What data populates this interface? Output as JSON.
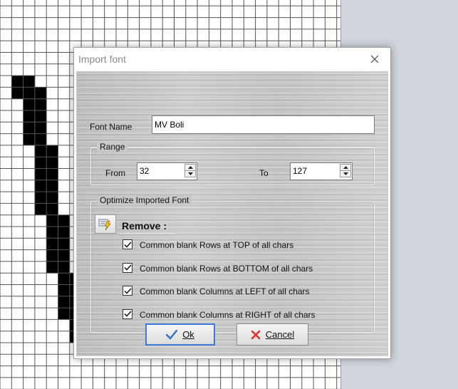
{
  "dialog": {
    "title": "Import font",
    "font_name_label": "Font Name",
    "font_name_value": "MV Boli",
    "range": {
      "title": "Range",
      "from_label": "From",
      "from_value": "32",
      "to_label": "To",
      "to_value": "127"
    },
    "optimize": {
      "title": "Optimize Imported Font",
      "remove_label": "Remove :",
      "options": [
        {
          "label": "Common blank Rows at TOP of all chars",
          "checked": true
        },
        {
          "label": "Common blank Rows at BOTTOM of all chars",
          "checked": true
        },
        {
          "label": "Common blank Columns at LEFT of all chars",
          "checked": true
        },
        {
          "label": "Common blank Columns at RIGHT of all chars",
          "checked": true
        }
      ]
    },
    "ok_label": "Ok",
    "cancel_label": "Cancel"
  },
  "colors": {
    "accent": "#3d7bd8",
    "cancel_icon": "#e0332b",
    "ok_icon": "#2f6fd0"
  },
  "background_glyph_pixels": [
    [
      1,
      7
    ],
    [
      2,
      7
    ],
    [
      1,
      8
    ],
    [
      2,
      8
    ],
    [
      3,
      8
    ],
    [
      2,
      9
    ],
    [
      3,
      9
    ],
    [
      2,
      10
    ],
    [
      3,
      10
    ],
    [
      2,
      11
    ],
    [
      3,
      11
    ],
    [
      2,
      12
    ],
    [
      3,
      12
    ],
    [
      3,
      13
    ],
    [
      4,
      13
    ],
    [
      3,
      14
    ],
    [
      4,
      14
    ],
    [
      3,
      15
    ],
    [
      4,
      15
    ],
    [
      3,
      16
    ],
    [
      4,
      16
    ],
    [
      3,
      17
    ],
    [
      4,
      17
    ],
    [
      3,
      18
    ],
    [
      4,
      18
    ],
    [
      4,
      19
    ],
    [
      5,
      19
    ],
    [
      4,
      20
    ],
    [
      5,
      20
    ],
    [
      4,
      21
    ],
    [
      5,
      21
    ],
    [
      4,
      22
    ],
    [
      5,
      22
    ],
    [
      4,
      23
    ],
    [
      5,
      23
    ],
    [
      5,
      24
    ],
    [
      6,
      24
    ],
    [
      5,
      25
    ],
    [
      6,
      25
    ],
    [
      5,
      26
    ],
    [
      6,
      26
    ],
    [
      5,
      27
    ],
    [
      6,
      27
    ],
    [
      6,
      28
    ],
    [
      6,
      29
    ]
  ]
}
